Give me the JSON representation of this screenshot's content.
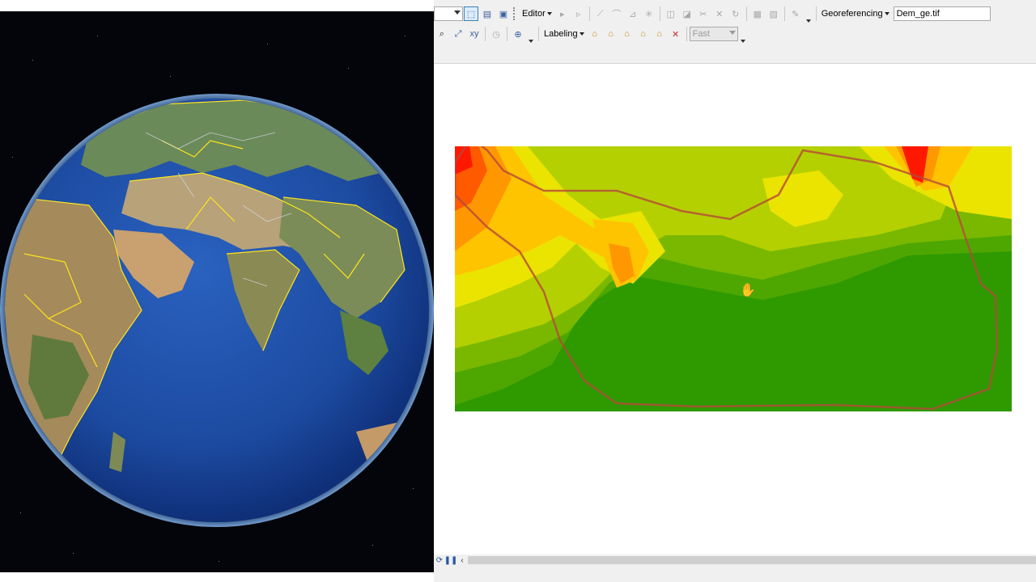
{
  "globe": {
    "background": "#04050a",
    "ocean_color": "#1f4fa8",
    "border_color_country": "#ffe41c",
    "border_color_internal": "#d9d9e6"
  },
  "toolbar": {
    "row1": {
      "layer_combo_value": "",
      "editor_label": "Editor",
      "georeferencing_label": "Georeferencing",
      "georef_layer_value": "Dem_ge.tif"
    },
    "row2": {
      "labeling_label": "Labeling",
      "label_quality_value": "Fast"
    }
  },
  "icons": {
    "full_extent": "⊞",
    "identify": "🔍",
    "pause": "❚❚",
    "refresh": "⟳",
    "scroll_left": "‹",
    "hand": "✋"
  },
  "dem": {
    "palette": [
      "#2e9a00",
      "#4ea700",
      "#7ab800",
      "#b5d000",
      "#eae400",
      "#ffc400",
      "#ff9800",
      "#ff5a00",
      "#ff1800"
    ],
    "boundary_color": "#b5483a"
  }
}
